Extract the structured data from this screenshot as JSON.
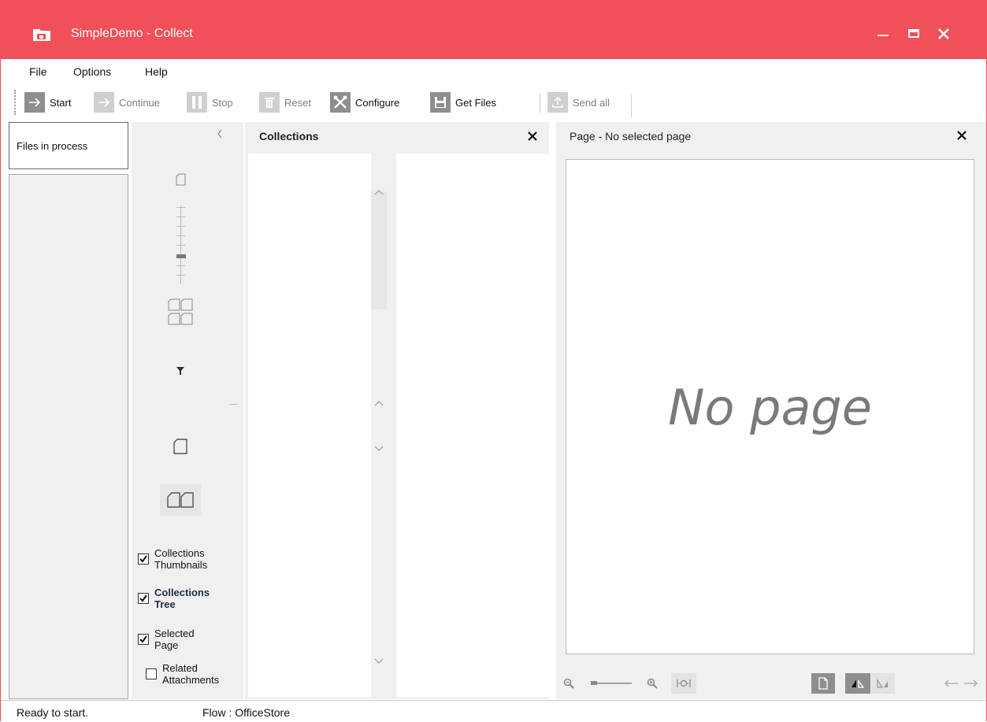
{
  "window": {
    "title": "SimpleDemo - Collect",
    "accent_color": "#f25058"
  },
  "menu": {
    "file": "File",
    "options": "Options",
    "help": "Help"
  },
  "toolbar": {
    "start": "Start",
    "continue": "Continue",
    "stop": "Stop",
    "reset": "Reset",
    "configure": "Configure",
    "get_files": "Get Files",
    "send_all": "Send all"
  },
  "sidebar": {
    "files_tab": "Files in process"
  },
  "view_options": {
    "collections_thumbnails": {
      "label_line1": "Collections",
      "label_line2": "Thumbnails",
      "checked": true
    },
    "collections_tree": {
      "label_line1": "Collections",
      "label_line2": "Tree",
      "checked": true
    },
    "selected_page": {
      "label_line1": "Selected",
      "label_line2": "Page",
      "checked": true
    },
    "related_attachments": {
      "label_line1": "Related",
      "label_line2": "Attachments",
      "checked": false
    }
  },
  "collections": {
    "title": "Collections"
  },
  "page": {
    "title": "Page - No selected page",
    "placeholder": "No page"
  },
  "status": {
    "message": "Ready to start.",
    "flow": "Flow : OfficeStore"
  }
}
